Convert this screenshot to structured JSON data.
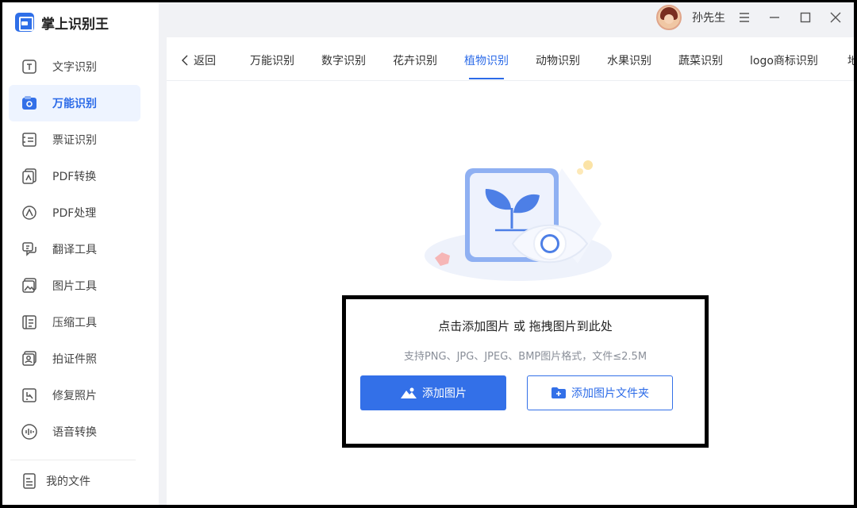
{
  "app": {
    "title": "掌上识别王"
  },
  "sidebar": {
    "items": [
      {
        "label": "文字识别",
        "icon": "text-icon"
      },
      {
        "label": "万能识别",
        "icon": "scan-icon",
        "active": true
      },
      {
        "label": "票证识别",
        "icon": "ticket-icon"
      },
      {
        "label": "PDF转换",
        "icon": "pdf-icon"
      },
      {
        "label": "PDF处理",
        "icon": "pdf-process-icon"
      },
      {
        "label": "翻译工具",
        "icon": "translate-icon"
      },
      {
        "label": "图片工具",
        "icon": "image-icon"
      },
      {
        "label": "压缩工具",
        "icon": "compress-icon"
      },
      {
        "label": "拍证件照",
        "icon": "id-photo-icon"
      },
      {
        "label": "修复照片",
        "icon": "repair-icon"
      },
      {
        "label": "语音转换",
        "icon": "voice-icon"
      }
    ],
    "footer": {
      "label": "我的文件",
      "icon": "file-icon"
    }
  },
  "user": {
    "name": "孙先生"
  },
  "tabs": {
    "back_label": "返回",
    "items": [
      "万能识别",
      "数字识别",
      "花卉识别",
      "植物识别",
      "动物识别",
      "水果识别",
      "蔬菜识别",
      "logo商标识别",
      "地"
    ],
    "active": "植物识别"
  },
  "upload": {
    "title": "点击添加图片 或 拖拽图片到此处",
    "hint": "支持PNG、JPG、JPEG、BMP图片格式，文件≤2.5M",
    "add_image_label": "添加图片",
    "add_folder_label": "添加图片文件夹"
  },
  "colors": {
    "accent": "#3370e8",
    "active_bg": "#eef4ff",
    "main_bg": "#f1f2f5"
  }
}
